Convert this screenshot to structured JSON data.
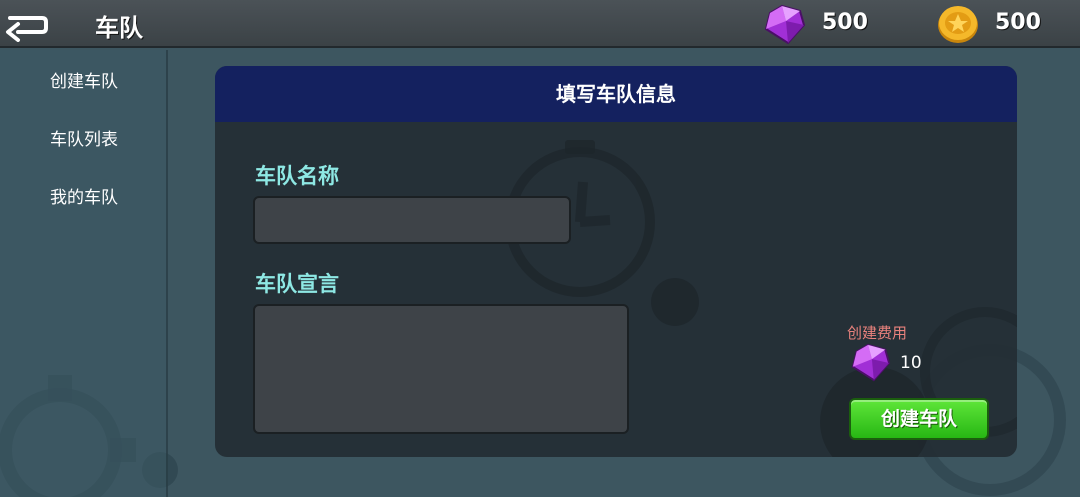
{
  "header": {
    "title": "车队",
    "back_icon": "back-arrow-icon",
    "gems": {
      "icon": "gem-icon",
      "value": "500",
      "color": "#b23be0"
    },
    "coins": {
      "icon": "coin-icon",
      "value": "500",
      "color": "#f0b020"
    }
  },
  "sidebar": {
    "items": [
      {
        "label": "创建车队"
      },
      {
        "label": "车队列表"
      },
      {
        "label": "我的车队"
      }
    ]
  },
  "panel": {
    "title": "填写车队信息",
    "name_label": "车队名称",
    "name_value": "",
    "motto_label": "车队宣言",
    "motto_value": "",
    "cost_label": "创建费用",
    "cost_icon": "gem-icon",
    "cost_value": "10",
    "create_button": "创建车队"
  },
  "colors": {
    "header_bar": "#14215f",
    "label_accent": "#8ee8e4",
    "cost_label": "#e9827d",
    "button_green": "#3fd424"
  }
}
